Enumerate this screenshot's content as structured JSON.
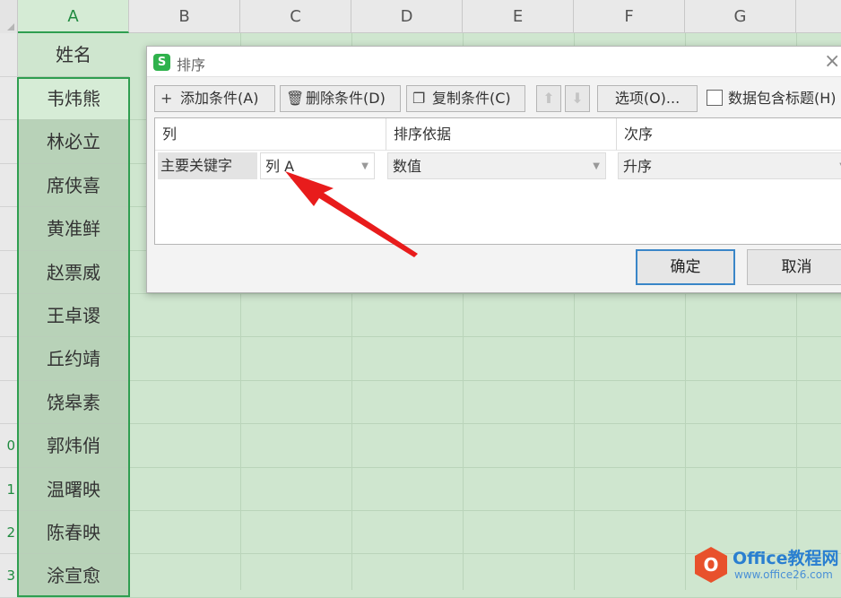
{
  "sheet": {
    "columns": [
      "A",
      "B",
      "C",
      "D",
      "E",
      "F",
      "G"
    ],
    "header_cell": "姓名",
    "rows": [
      {
        "num": "",
        "name": "韦炜熊"
      },
      {
        "num": "",
        "name": "林必立"
      },
      {
        "num": "",
        "name": "席侠喜"
      },
      {
        "num": "",
        "name": "黄准鲜"
      },
      {
        "num": "",
        "name": "赵票威"
      },
      {
        "num": "",
        "name": "王卓谡"
      },
      {
        "num": "",
        "name": "丘约靖"
      },
      {
        "num": "",
        "name": "饶皋素"
      },
      {
        "num": "0",
        "name": "郭炜俏"
      },
      {
        "num": "1",
        "name": "温曙映"
      },
      {
        "num": "2",
        "name": "陈春映"
      },
      {
        "num": "3",
        "name": "涂宣愈"
      }
    ]
  },
  "dialog": {
    "title": "排序",
    "app_icon_letter": "S",
    "close_glyph": "×",
    "toolbar": {
      "add_label": "添加条件(A)",
      "delete_label": "删除条件(D)",
      "copy_label": "复制条件(C)",
      "up_glyph": "⬆",
      "down_glyph": "⬇",
      "options_label": "选项(O)...",
      "header_checkbox_label": "数据包含标题(H)",
      "header_checkbox_checked": false
    },
    "grid": {
      "headers": [
        "列",
        "排序依据",
        "次序"
      ],
      "row": {
        "label": "主要关键字",
        "column_value": "列 A",
        "basis_value": "数值",
        "order_value": "升序"
      }
    },
    "ok_label": "确定",
    "cancel_label": "取消"
  },
  "colors": {
    "selection_green": "#2f9e50",
    "annotation_arrow": "#e81c1c",
    "primary_button_border": "#3a86c8"
  },
  "watermark": {
    "line1": "Office教程网",
    "line2": "www.office26.com"
  }
}
